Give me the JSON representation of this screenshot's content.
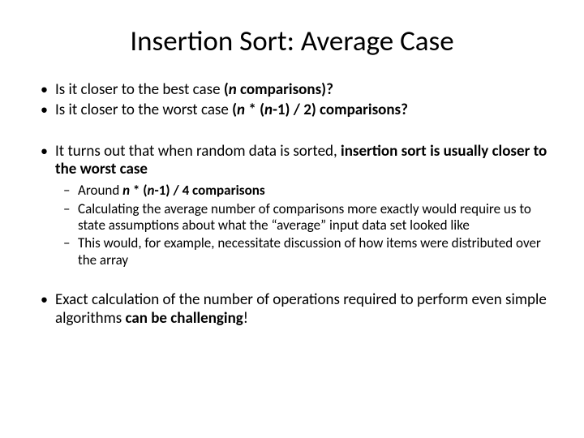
{
  "title": "Insertion Sort: Average Case",
  "b1a": "Is it closer to the best case ",
  "b1b_pre": "(",
  "b1b_n": "n",
  "b1b_post": " comparisons)?",
  "b2a": "Is it closer to the worst case ",
  "b2b_pre": "(",
  "b2b_n": "n",
  "b2b_mid": " * (",
  "b2b_n2": "n",
  "b2b_post": "-1) / 2) comparisons?",
  "b3a": "It turns out that when random data is sorted, ",
  "b3b": "insertion sort is usually closer to the worst case",
  "s1a": "Around ",
  "s1_n": "n",
  "s1_mid": " * (",
  "s1_n2": "n",
  "s1_post": "-1) / 4 comparisons",
  "s2": "Calculating the average number of comparisons more exactly would require us to state assumptions about what the “average” input data set looked like",
  "s3": "This would, for example, necessitate discussion of how items were distributed over the array",
  "b4a": "Exact calculation of the number of operations required to perform even simple algorithms ",
  "b4b": "can be challenging",
  "b4c": "!"
}
